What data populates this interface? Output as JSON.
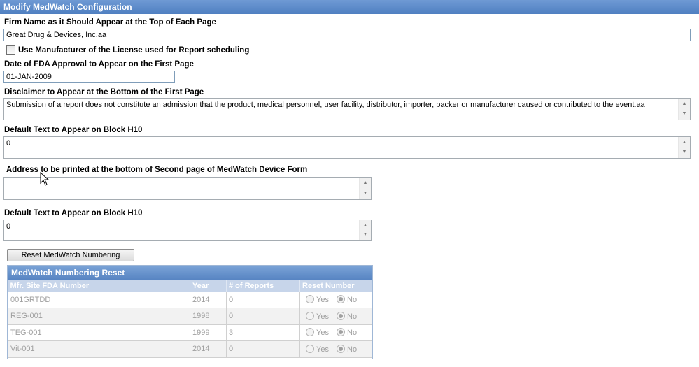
{
  "title": "Modify MedWatch Configuration",
  "firm_name": {
    "label": "Firm Name as it Should Appear at the Top of Each Page",
    "value": "Great Drug & Devices, Inc.aa"
  },
  "use_manufacturer": {
    "label": "Use Manufacturer of the License used for Report scheduling",
    "checked": false
  },
  "fda_date": {
    "label": "Date of FDA Approval to Appear on the First Page",
    "value": "01-JAN-2009"
  },
  "disclaimer": {
    "label": "Disclaimer to Appear at the Bottom of the First Page",
    "value": "Submission of a report does not constitute an admission that the product, medical personnel, user facility, distributor, importer, packer or manufacturer caused or contributed to the event.aa"
  },
  "block_h10_a": {
    "label": "Default Text to Appear on Block H10",
    "value": "0"
  },
  "address": {
    "label": "Address to be printed at the bottom of Second page of MedWatch Device Form",
    "value": ""
  },
  "block_h10_b": {
    "label": "Default Text to Appear on Block H10",
    "value": "0"
  },
  "reset_button": "Reset MedWatch Numbering",
  "numbering": {
    "title": "MedWatch Numbering Reset",
    "columns": [
      "Mfr. Site FDA Number",
      "Year",
      "# of Reports",
      "Reset Number"
    ],
    "yes_label": "Yes",
    "no_label": "No",
    "rows": [
      {
        "site": "001GRTDD",
        "year": "2014",
        "reports": "0",
        "selected": "No"
      },
      {
        "site": "REG-001",
        "year": "1998",
        "reports": "0",
        "selected": "No"
      },
      {
        "site": "TEG-001",
        "year": "1999",
        "reports": "3",
        "selected": "No"
      },
      {
        "site": "Vit-001",
        "year": "2014",
        "reports": "0",
        "selected": "No"
      }
    ]
  }
}
